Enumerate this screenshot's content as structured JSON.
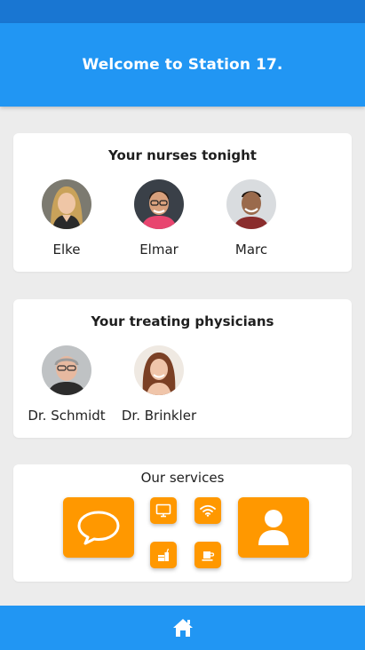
{
  "header": {
    "title": "Welcome to Station 17."
  },
  "nurses": {
    "title": "Your nurses tonight",
    "people": [
      {
        "name": "Elke"
      },
      {
        "name": "Elmar"
      },
      {
        "name": "Marc"
      }
    ]
  },
  "physicians": {
    "title": "Your treating physicians",
    "people": [
      {
        "name": "Dr. Schmidt"
      },
      {
        "name": "Dr. Brinkler"
      }
    ]
  },
  "services": {
    "title": "Our services",
    "items": [
      {
        "icon": "chat-bubble-icon"
      },
      {
        "icon": "tv-icon"
      },
      {
        "icon": "wifi-icon"
      },
      {
        "icon": "drink-icon"
      },
      {
        "icon": "coffee-icon"
      },
      {
        "icon": "user-icon"
      }
    ]
  },
  "nav": {
    "home_icon": "home-icon"
  },
  "colors": {
    "status_bar": "#1976d2",
    "header": "#2196f3",
    "accent": "#ff9800",
    "background": "#ececec"
  }
}
